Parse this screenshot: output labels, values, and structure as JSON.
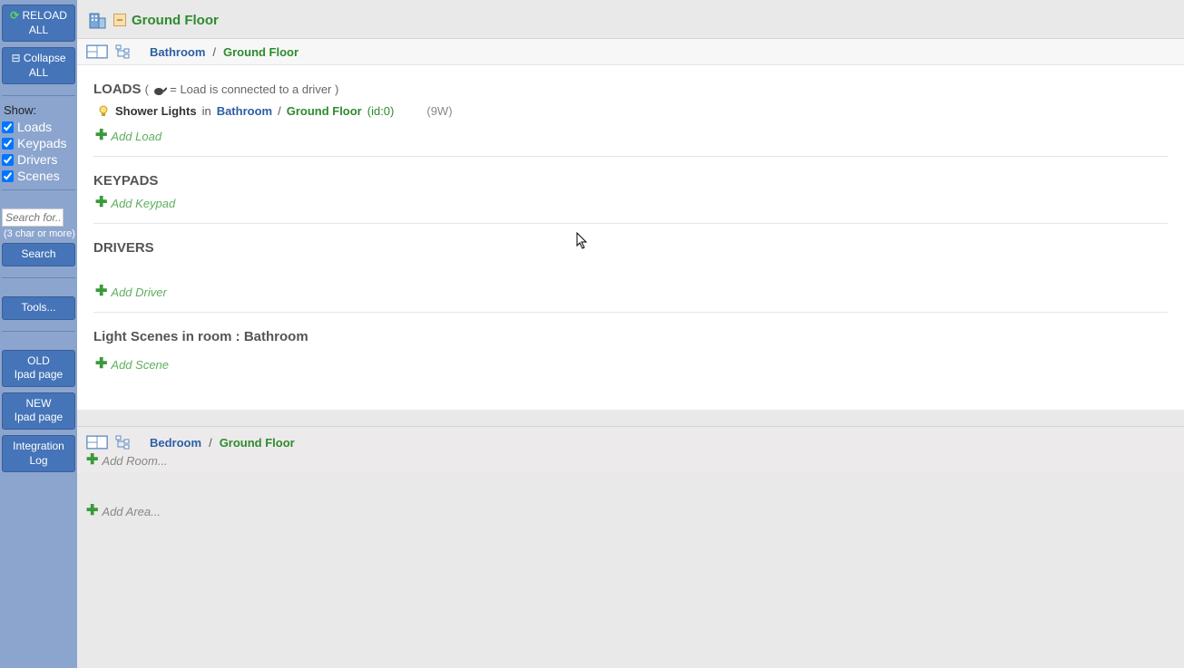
{
  "sidebar": {
    "reload": "RELOAD ALL",
    "collapse": "Collapse ALL",
    "show_label": "Show:",
    "checks": [
      "Loads",
      "Keypads",
      "Drivers",
      "Scenes"
    ],
    "search_placeholder": "Search for...",
    "search_hint": "(3 char or more)",
    "search_btn": "Search",
    "tools_btn": "Tools...",
    "old_ipad": "OLD\nIpad page",
    "new_ipad": "NEW\nIpad page",
    "integration": "Integration Log"
  },
  "area": {
    "title": "Ground Floor"
  },
  "room1": {
    "name": "Bathroom",
    "area": "Ground Floor",
    "loads": {
      "title": "LOADS",
      "hint_prefix": " ( ",
      "hint_suffix": " = Load is connected to a driver )",
      "items": [
        {
          "name": "Shower Lights",
          "in": " in",
          "room": "Bathroom",
          "sep": " /",
          "area": "Ground Floor",
          "id": " (id:0)",
          "watts": "(9W)"
        }
      ],
      "add": "Add Load"
    },
    "keypads": {
      "title": "KEYPADS",
      "add": "Add Keypad"
    },
    "drivers": {
      "title": "DRIVERS",
      "add": "Add Driver"
    },
    "scenes": {
      "title": "Light Scenes in room : Bathroom",
      "add": "Add Scene"
    }
  },
  "room2": {
    "name": "Bedroom",
    "area": "Ground Floor",
    "add_room": "Add Room..."
  },
  "add_area": "Add Area..."
}
